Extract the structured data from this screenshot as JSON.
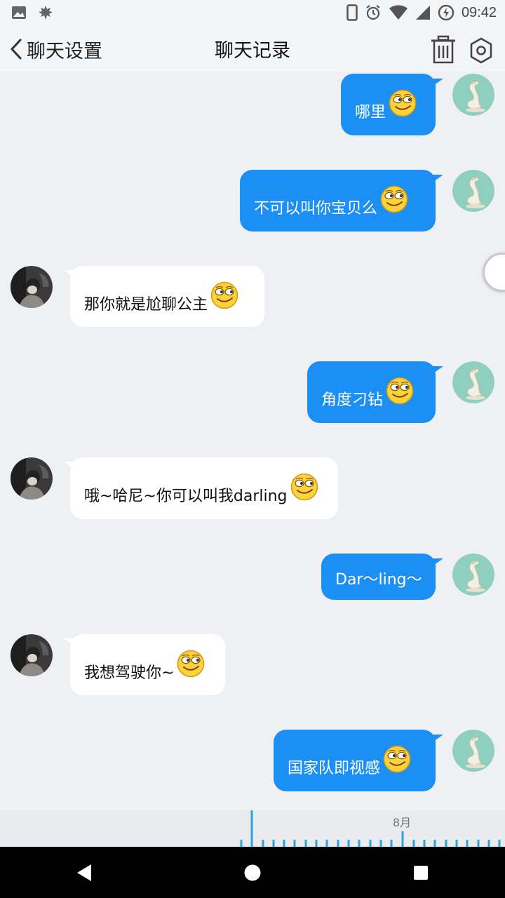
{
  "status_bar": {
    "time": "09:42",
    "icons": [
      "image-icon",
      "leaf-icon",
      "phone-icon",
      "alarm-icon",
      "wifi-icon",
      "signal-icon",
      "battery-charging-icon"
    ]
  },
  "nav": {
    "back_label": "聊天设置",
    "title": "聊天记录",
    "actions": [
      "trash-icon",
      "settings-icon"
    ]
  },
  "messages": [
    {
      "side": "out",
      "text": "哪里",
      "emoji": "smirk-emoji"
    },
    {
      "side": "out",
      "text": "不可以叫你宝贝么",
      "emoji": "smirk-emoji"
    },
    {
      "side": "in",
      "text": "那你就是尬聊公主",
      "emoji": "smirk-emoji"
    },
    {
      "side": "out",
      "text": "角度刁钻",
      "emoji": "smirk-emoji"
    },
    {
      "side": "in",
      "text": "哦~哈尼~你可以叫我darling",
      "emoji": "smirk-emoji"
    },
    {
      "side": "out",
      "text": "Dar～ling～",
      "emoji": ""
    },
    {
      "side": "in",
      "text": "我想驾驶你~",
      "emoji": "smirk-emoji"
    },
    {
      "side": "out",
      "text": "国家队即视感",
      "emoji": "smirk-emoji"
    }
  ],
  "timeline": {
    "month_label": "8月"
  },
  "colors": {
    "outgoing_bubble": "#1c8ff5",
    "incoming_bubble": "#ffffff",
    "background": "#eef0f3",
    "timeline_accent": "#2aa3e6"
  }
}
